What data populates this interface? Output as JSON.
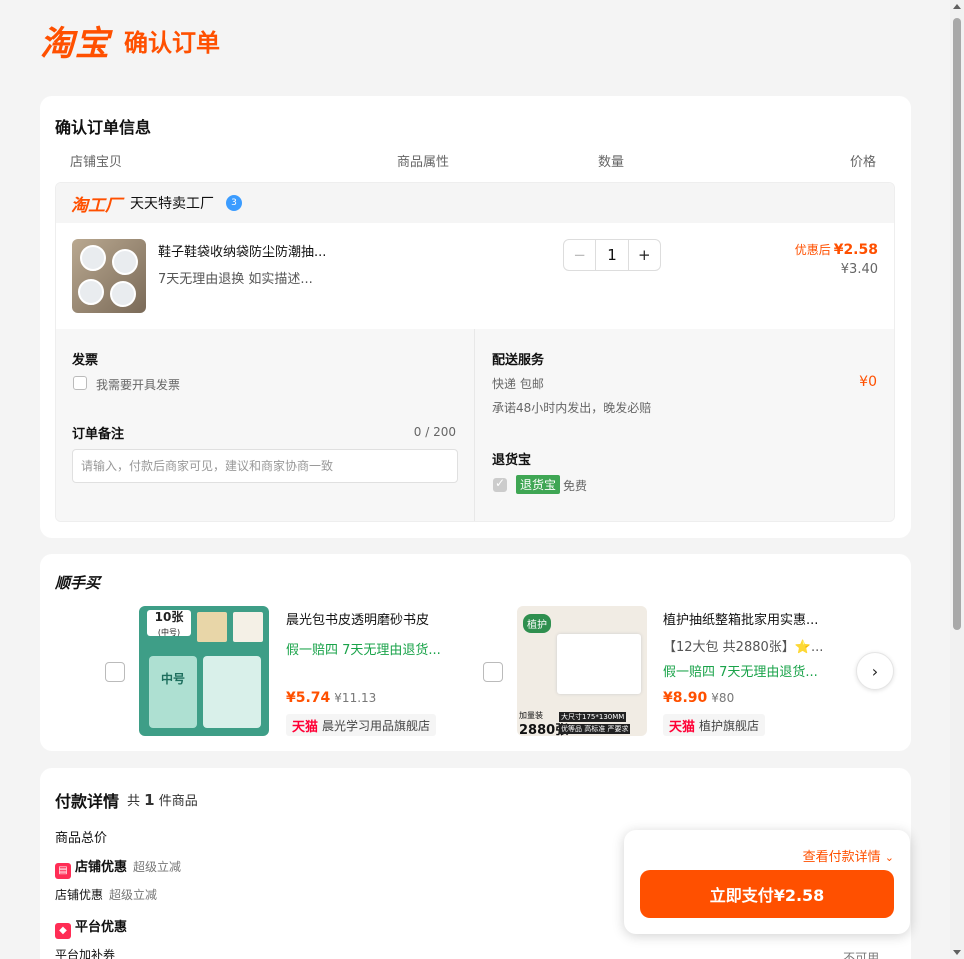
{
  "header": {
    "logo": "淘宝",
    "title": "确认订单"
  },
  "order": {
    "section_title": "确认订单信息",
    "columns": [
      "店铺宝贝",
      "商品属性",
      "数量",
      "价格"
    ],
    "shop": {
      "logo": "淘工厂",
      "name": "天天特卖工厂",
      "badge": "3"
    },
    "item": {
      "title": "鞋子鞋袋收纳袋防尘防潮抽...",
      "sub": "7天无理由退换  如实描述...",
      "quantity": "1",
      "price_label": "优惠后",
      "price_after": "¥2.58",
      "price_original": "¥3.40"
    },
    "invoice": {
      "label": "发票",
      "checkbox_label": "我需要开具发票"
    },
    "note": {
      "label": "订单备注",
      "counter": "0 / 200",
      "placeholder": "请输入，付款后商家可见，建议和商家协商一致"
    },
    "delivery": {
      "label": "配送服务",
      "method": "快递 包邮",
      "price": "¥0",
      "promise": "承诺48小时内发出，晚发必赔"
    },
    "return_insurance": {
      "label": "退货宝",
      "tag": "退货宝",
      "free": "免费"
    }
  },
  "shunshou": {
    "title": "顺手买",
    "products": [
      {
        "title": "晨光包书皮透明磨砂书皮",
        "tags": "假一赔四  7天无理由退货...",
        "price": "¥5.74",
        "original": "¥11.13",
        "store_brand": "天猫",
        "store": "晨光学习用品旗舰店",
        "img_top": "10张",
        "img_sub": "(中号)",
        "img_main": "中号"
      },
      {
        "title": "植护抽纸整箱批家用实惠...",
        "specs": "【12大包 共2880张】⭐...",
        "tags": "假一赔四  7天无理由退货...",
        "price": "¥8.90",
        "original": "¥80",
        "store_brand": "天猫",
        "store": "植护旗舰店",
        "img_tag": "植护",
        "img_count": "2880张",
        "img_size": "大尺寸175*130MM",
        "img_banner": "优等品 高标准 严要求",
        "img_extra": "加量装"
      }
    ]
  },
  "payment": {
    "title": "付款详情",
    "count_prefix": "共",
    "count": "1",
    "count_suffix": "件商品",
    "total_label": "商品总价",
    "shop_discount_title": "店铺优惠",
    "shop_discount_sub": "超级立减",
    "shop_discount_row": "店铺优惠",
    "shop_discount_row_sub": "超级立减",
    "platform_discount_title": "平台优惠",
    "platform_coupon": "平台加补券",
    "not_available": "不可用"
  },
  "pay_panel": {
    "detail_link": "查看付款详情",
    "button": "立即支付¥2.58"
  },
  "colors": {
    "accent": "#ff5000",
    "green": "#1aa34a",
    "tmall": "#ff0036"
  }
}
